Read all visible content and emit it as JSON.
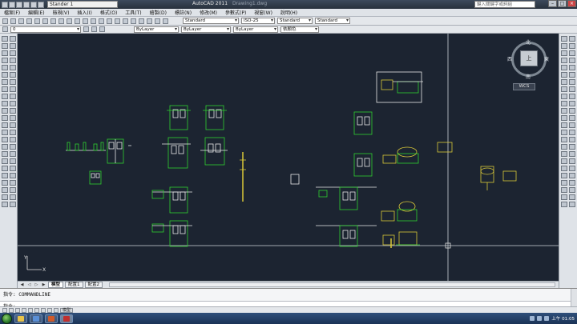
{
  "titlebar": {
    "workspace": "Stander 1",
    "app_title": "AutoCAD 2011",
    "file_name": "Drawing1.dwg",
    "search_placeholder": "鍵入關鍵字或詞組"
  },
  "menubar": {
    "items": [
      "檔案(F)",
      "編輯(E)",
      "檢視(V)",
      "插入(I)",
      "格式(O)",
      "工具(T)",
      "繪製(D)",
      "標註(N)",
      "修改(M)",
      "參數式(P)",
      "視窗(W)",
      "說明(H)"
    ]
  },
  "styles": {
    "text_style": "Standard",
    "dim_style": "ISO-25",
    "table_style": "Standard",
    "multileader_style": "Standard"
  },
  "properties": {
    "layer": "0",
    "color": "ByLayer",
    "linetype": "ByLayer",
    "lineweight": "ByLayer",
    "plotstyle": "依顏色"
  },
  "viewcube": {
    "face": "上",
    "north": "北",
    "south": "南",
    "east": "東",
    "west": "西",
    "wcs": "WCS"
  },
  "layout_tabs": [
    "模型",
    "配置1",
    "配置2"
  ],
  "command": {
    "history_line": "指令: COMMANDLINE",
    "prompt": "指令:"
  },
  "statusbar": {
    "buttons": [
      "模型"
    ]
  },
  "taskbar": {
    "clock": "上午 01:05"
  },
  "colors": {
    "canvas_bg": "#1c2431",
    "entity_green": "#2fd02f",
    "entity_yellow": "#d9c838",
    "entity_white": "#e8e8e8"
  }
}
